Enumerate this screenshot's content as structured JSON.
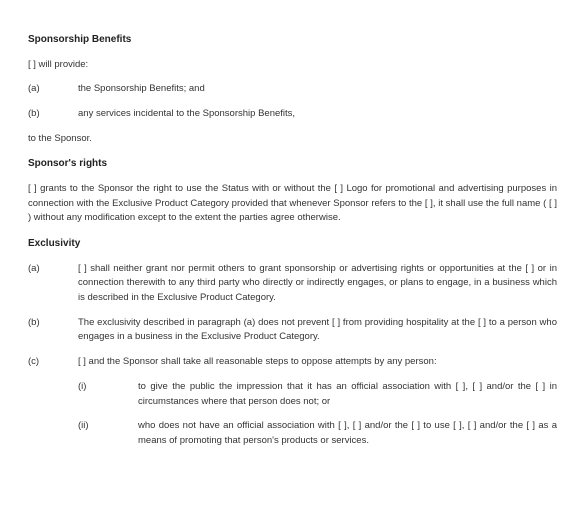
{
  "s1": {
    "heading": "Sponsorship Benefits",
    "intro": "[ ] will provide:",
    "items": [
      {
        "marker": "(a)",
        "text": "the Sponsorship Benefits; and"
      },
      {
        "marker": "(b)",
        "text": "any services incidental to the Sponsorship Benefits,"
      }
    ],
    "outro": "to the Sponsor."
  },
  "s2": {
    "heading": "Sponsor's rights",
    "text": "[ ] grants to the Sponsor the right to use the Status with or without the [ ] Logo for promotional and advertising purposes in connection with the Exclusive Product Category provided that whenever Sponsor refers to the [ ], it shall use the full name ( [ ] ) without any modification except to the extent the parties agree otherwise."
  },
  "s3": {
    "heading": "Exclusivity",
    "items": [
      {
        "marker": "(a)",
        "text": "[ ] shall neither grant nor permit others to grant sponsorship or advertising rights or opportunities at the [ ] or in connection therewith to any third party who directly or indirectly engages, or plans to engage, in a business which is described in the Exclusive Product Category."
      },
      {
        "marker": "(b)",
        "text": "The exclusivity described in paragraph (a) does not prevent [ ] from providing hospitality at the [ ] to a person who engages in a business in the Exclusive Product Category."
      },
      {
        "marker": "(c)",
        "text": "[ ] and the Sponsor shall take all reasonable steps to oppose attempts by any person:",
        "subs": [
          {
            "marker": "(i)",
            "text": "to give the public the impression that it has an official association with [ ], [ ] and/or the [ ] in circumstances where that person does not; or"
          },
          {
            "marker": "(ii)",
            "text": "who does not have an official association with [ ], [ ] and/or the [ ] to use [ ], [ ] and/or the [ ] as a means of promoting that person's products or services."
          }
        ]
      }
    ]
  }
}
